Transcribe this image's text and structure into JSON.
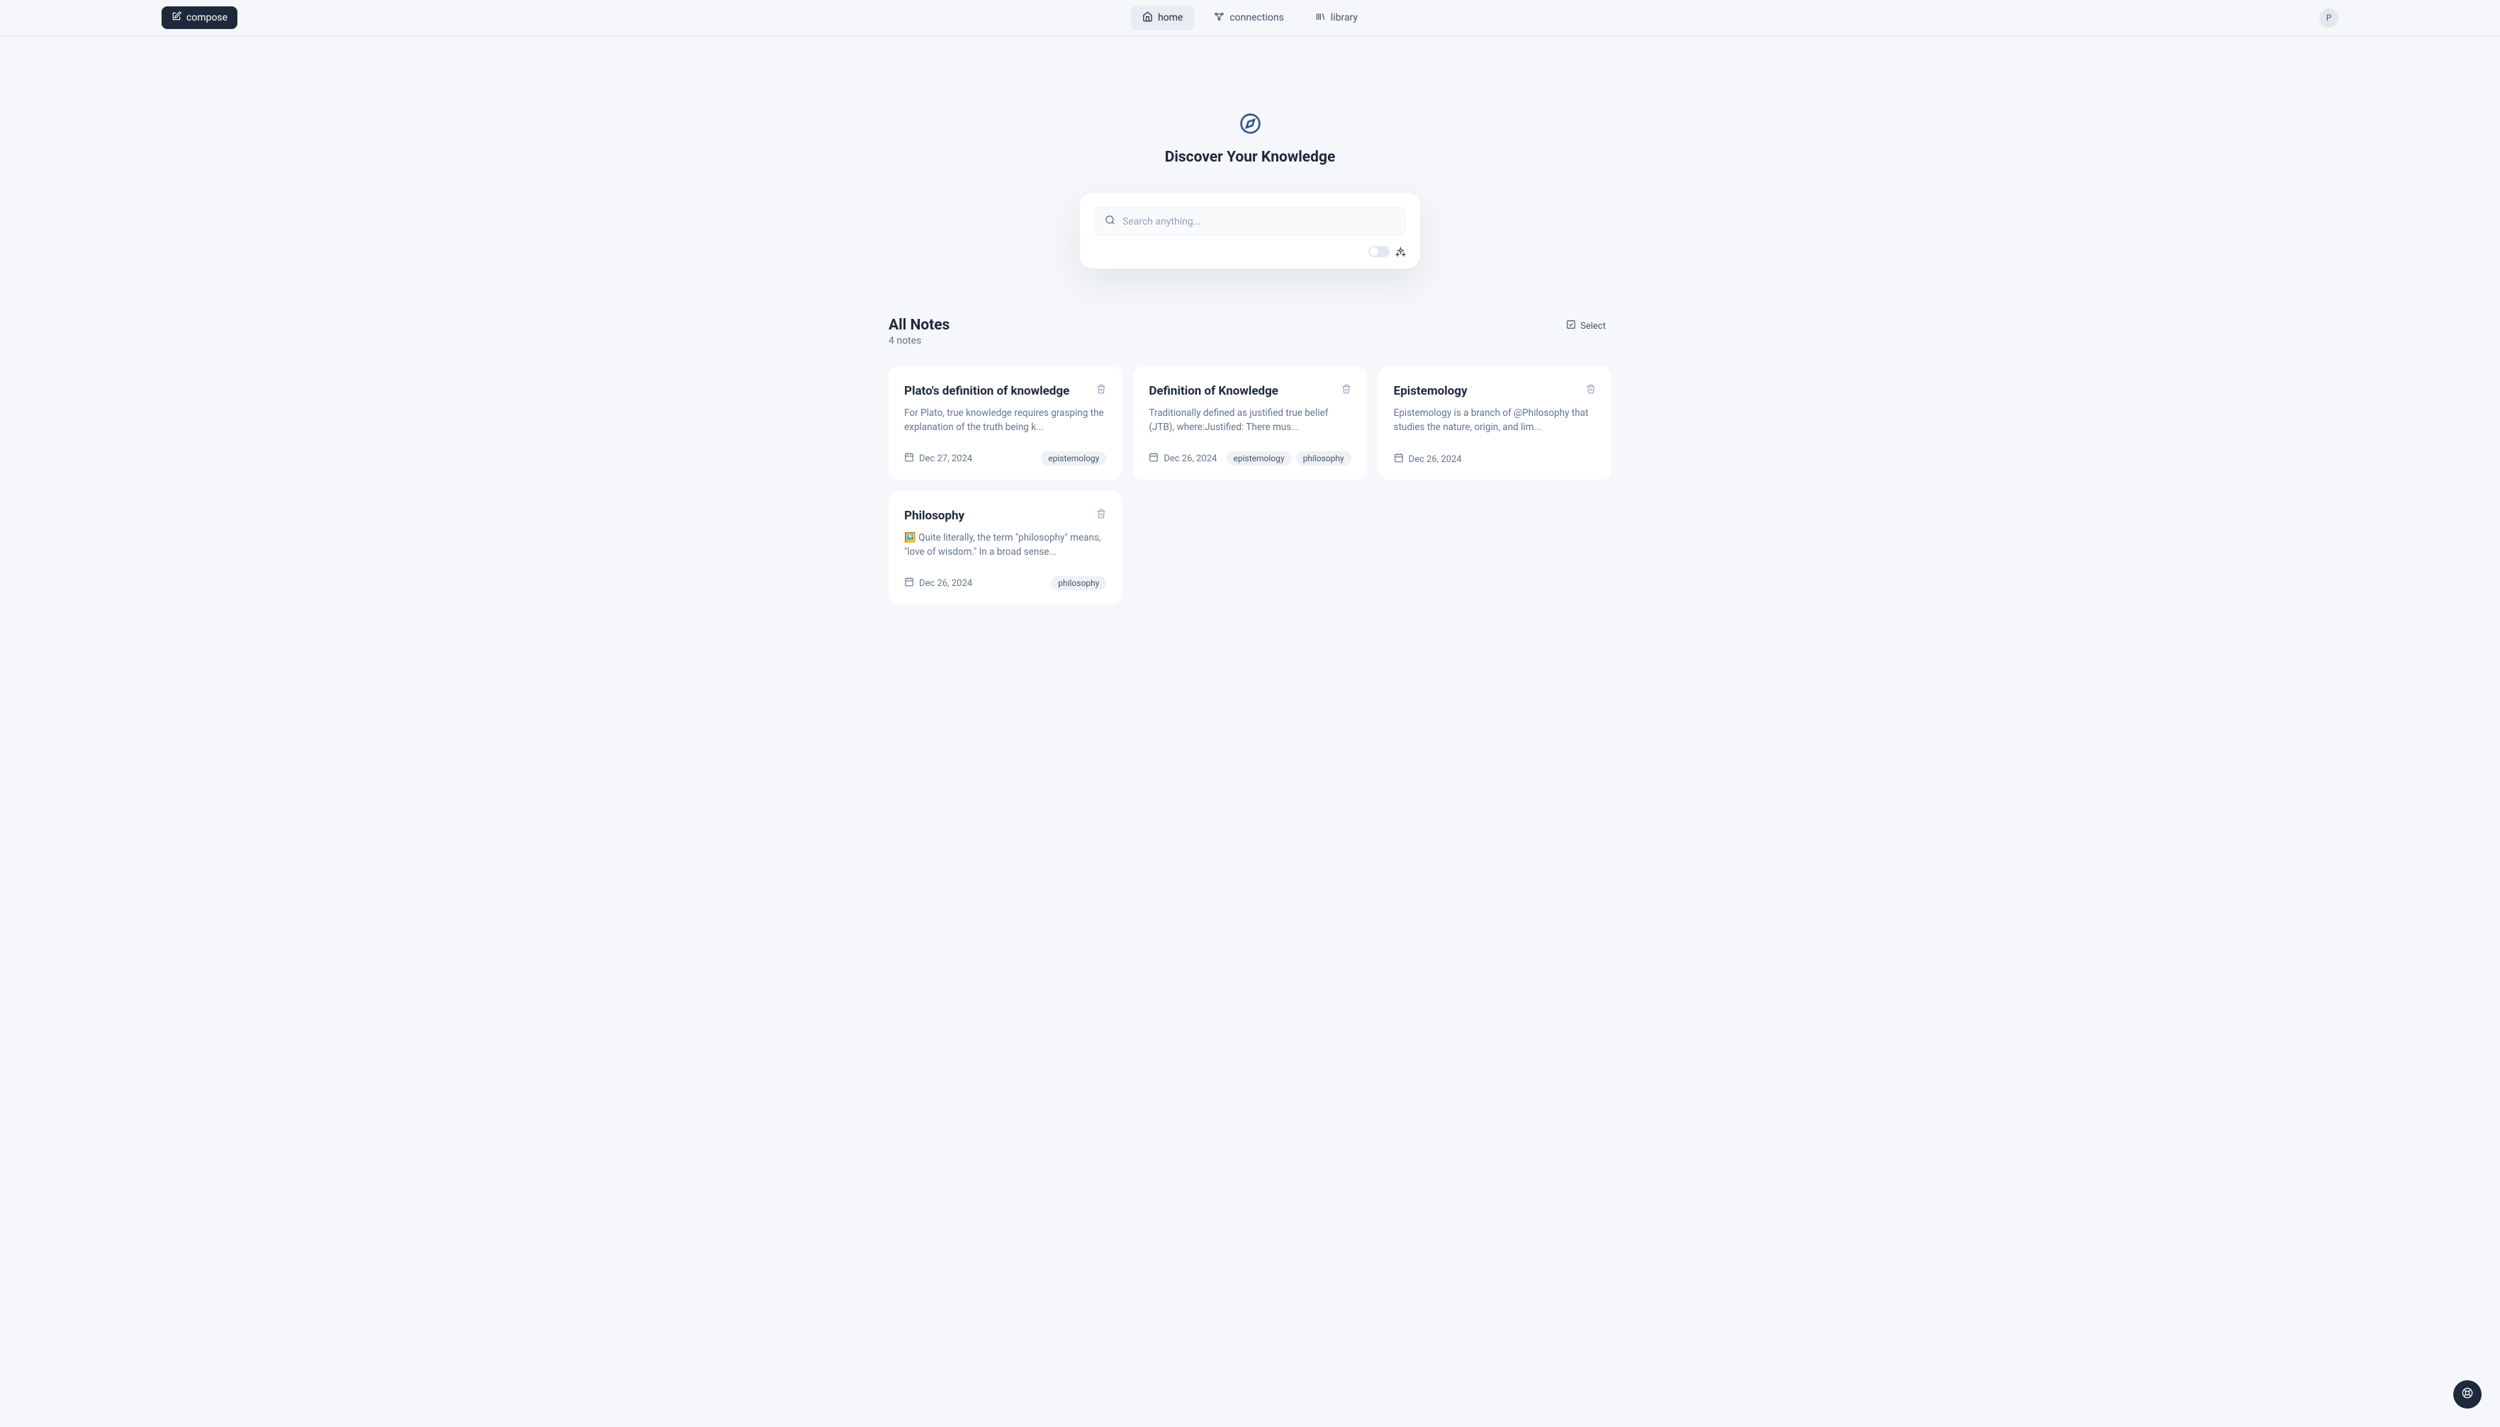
{
  "header": {
    "compose_label": "compose",
    "nav": {
      "home": "home",
      "connections": "connections",
      "library": "library"
    },
    "avatar_letter": "P"
  },
  "hero": {
    "title": "Discover Your Knowledge"
  },
  "search": {
    "placeholder": "Search anything..."
  },
  "section": {
    "title": "All Notes",
    "count": "4 notes",
    "select_label": "Select"
  },
  "notes": [
    {
      "title": "Plato's definition of knowledge",
      "excerpt": "For Plato, true knowledge requires grasping the explanation of the truth being k...",
      "date": "Dec 27, 2024",
      "tags": [
        "epistemology"
      ]
    },
    {
      "title": "Definition of Knowledge",
      "excerpt": "Traditionally defined as justified true belief (JTB), where:Justified: There mus...",
      "date": "Dec 26, 2024",
      "tags": [
        "epistemology",
        "philosophy"
      ]
    },
    {
      "title": "Epistemology",
      "excerpt": "Epistemology is a branch of @Philosophy that studies the nature, origin, and lim...",
      "date": "Dec 26, 2024",
      "tags": []
    },
    {
      "title": "Philosophy",
      "excerpt": "🖼️  Quite literally, the term \"philosophy\" means, \"love of wisdom.\" In a broad sense...",
      "date": "Dec 26, 2024",
      "tags": [
        "philosophy"
      ]
    }
  ]
}
